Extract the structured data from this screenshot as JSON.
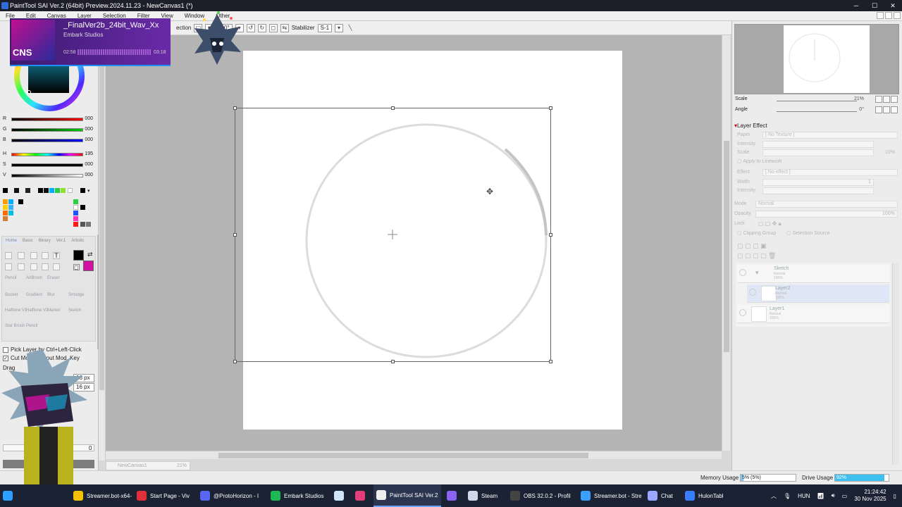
{
  "window": {
    "title": "PaintTool SAI Ver.2 (64bit) Preview.2024.11.23 - NewCanvas1 (*)"
  },
  "menu": [
    "File",
    "Edit",
    "Canvas",
    "Layer",
    "Selection",
    "Filter",
    "View",
    "Window",
    "Other"
  ],
  "tool_options": {
    "selection_label": "ection",
    "angle_value": "0.0°",
    "stabilizer_label": "Stabilizer",
    "stabilizer_value": "S-1"
  },
  "color_sliders": [
    {
      "label": "R",
      "value": "000",
      "gradient": "linear-gradient(90deg,#000,#f00)"
    },
    {
      "label": "G",
      "value": "000",
      "gradient": "linear-gradient(90deg,#000,#0c0)"
    },
    {
      "label": "B",
      "value": "000",
      "gradient": "linear-gradient(90deg,#000,#00f)"
    },
    {
      "label": "H",
      "value": "195",
      "gradient": "linear-gradient(90deg,#f00,#ff0,#0f0,#0ff,#00f,#f0f,#f00)"
    },
    {
      "label": "S",
      "value": "000",
      "gradient": "linear-gradient(90deg,#000,#000)"
    },
    {
      "label": "V",
      "value": "000",
      "gradient": "linear-gradient(90deg,#000,#fff)"
    }
  ],
  "tool_palette": {
    "tabs": [
      "Home",
      "Basic",
      "Binary",
      "Ver.1",
      "Artistic"
    ],
    "tools": [
      {
        "label": "Pencil"
      },
      {
        "label": "AirBrush"
      },
      {
        "label": "Eraser"
      },
      {
        "label": "Bucket"
      },
      {
        "label": "Gradient"
      },
      {
        "label": "Blur"
      },
      {
        "label": "Smudge"
      },
      {
        "label": "Halftone V1"
      },
      {
        "label": "Halftone V2"
      },
      {
        "label": "Marker"
      },
      {
        "label": "Sketch"
      },
      {
        "label": "Star Brush"
      },
      {
        "label": "Pencil"
      }
    ]
  },
  "tool_checks": [
    {
      "label": "Pick Layer by Ctrl+Left-Click",
      "checked": false
    },
    {
      "label": "Cut Move without Mod. Key",
      "checked": true
    },
    {
      "label": "Drag",
      "checked": false
    }
  ],
  "tool_fields": [
    "16 px",
    "16 px"
  ],
  "tool_bottom_value": "0",
  "navigator": {
    "scale_label": "Scale",
    "scale_value": "21%",
    "angle_label": "Angle",
    "angle_value": "0°"
  },
  "layer_effect": {
    "header": "Layer Effect",
    "paper_label": "Paper",
    "paper_value": "[ No Texture ]",
    "intensity_label": "Intensity",
    "scale_label": "Scale",
    "scale_value": "10%",
    "apply_label": "Apply to Linework",
    "effect_label": "Effect",
    "effect_value": "[ No effect ]",
    "width_label": "Width",
    "width_value": "1",
    "intensity2_label": "Intensity",
    "mode_label": "Mode",
    "mode_value": "Normal",
    "opacity_label": "Opacity",
    "opacity_value": "100%",
    "lock_label": "Lock",
    "clipping_label": "Clipping Group",
    "selection_source_label": "Selection Source"
  },
  "layers": [
    {
      "name": "Sketch",
      "mode": "Normal",
      "opacity": "100%",
      "selected": false
    },
    {
      "name": "Layer2",
      "mode": "Normal",
      "opacity": "100%",
      "selected": true
    },
    {
      "name": "Layer1",
      "mode": "Normal",
      "opacity": "100%",
      "selected": false
    }
  ],
  "canvas_tab": {
    "name": "NewCanvas1",
    "zoom": "21%"
  },
  "status": {
    "memory_label": "Memory Usage",
    "memory_value": "5% (5%)",
    "memory_fraction": 0.05,
    "drive_label": "Drive Usage",
    "drive_value": "92%",
    "drive_fraction": 0.92
  },
  "now_playing": {
    "art_text": "CNS",
    "title": "_FinalVer2b_24bit_Wav_Xx",
    "artist": "Embark Studios",
    "elapsed": "02:58",
    "total": "03:18"
  },
  "taskbar": {
    "items": [
      {
        "label": "Streamer.bot-x64-",
        "color": "#f5c200",
        "active": false
      },
      {
        "label": "Start Page - Viv",
        "color": "#e0313b",
        "active": false
      },
      {
        "label": "@ProtoHorizon - I",
        "color": "#5865f2",
        "active": false
      },
      {
        "label": "Embark Studios",
        "color": "#1db954",
        "active": false
      },
      {
        "label": "",
        "color": "#cfe4ff",
        "active": false
      },
      {
        "label": "",
        "color": "#e33d7a",
        "active": false
      },
      {
        "label": "PaintTool SAI Ver.2",
        "color": "#eeeeee",
        "active": true
      },
      {
        "label": "",
        "color": "#8a63f0",
        "active": false
      },
      {
        "label": "Steam",
        "color": "#cfd8e8",
        "active": false
      },
      {
        "label": "OBS 32.0.2 - Profil",
        "color": "#444444",
        "active": false
      },
      {
        "label": "Streamer.bot - Stre",
        "color": "#3aa0ff",
        "active": false
      },
      {
        "label": "Chat",
        "color": "#9aa6ff",
        "active": false
      },
      {
        "label": "HulonTabl",
        "color": "#3a7dff",
        "active": false
      }
    ],
    "lang": "HUN",
    "time": "21:24:42",
    "date": "30 Nov 2025"
  }
}
